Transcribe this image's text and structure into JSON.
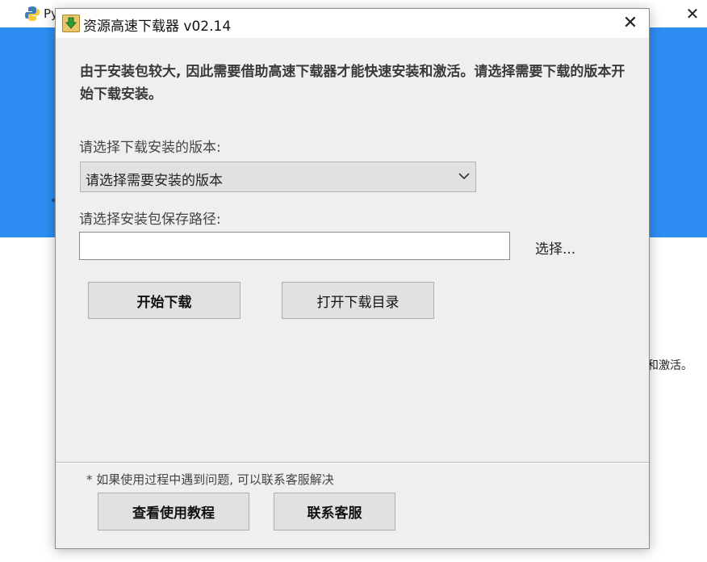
{
  "background": {
    "title": "Py",
    "trailing_text": "和激活。"
  },
  "dialog": {
    "title": "资源高速下载器 v02.14",
    "intro": "由于安装包较大, 因此需要借助高速下载器才能快速安装和激活。请选择需要下载的版本开始下载安装。",
    "version_label": "请选择下载安装的版本:",
    "version_select": "请选择需要安装的版本",
    "path_label": "请选择安装包保存路径:",
    "path_value": "",
    "browse_label": "选择...",
    "start_download": "开始下载",
    "open_folder": "打开下载目录",
    "note": "* 如果使用过程中遇到问题, 可以联系客服解决",
    "tutorial": "查看使用教程",
    "support": "联系客服"
  },
  "colors": {
    "banner": "#2e8df2",
    "dialog_bg": "#efefef",
    "button_bg": "#e1e1e1"
  },
  "icons": [
    "python-logo-icon",
    "close-icon",
    "download-arrow-icon",
    "chevron-down-icon"
  ]
}
